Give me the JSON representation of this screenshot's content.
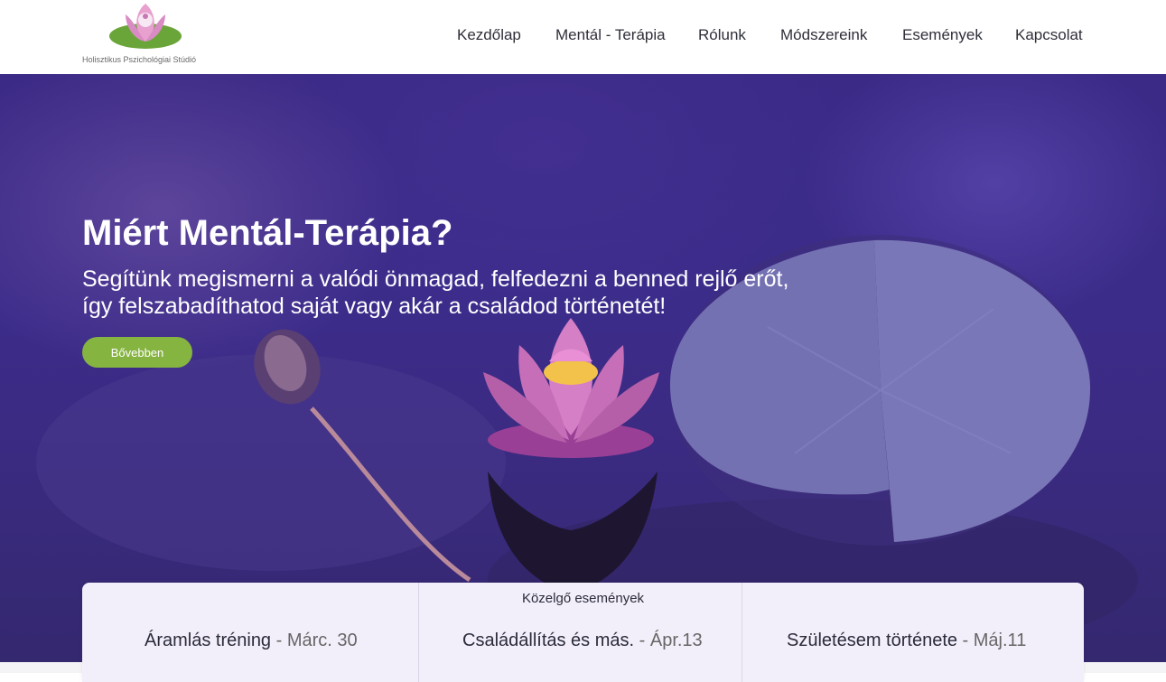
{
  "header": {
    "logo_text": "Holisztikus Pszichológiai Stúdió",
    "nav": [
      {
        "label": "Kezdőlap"
      },
      {
        "label": "Mentál - Terápia"
      },
      {
        "label": "Rólunk"
      },
      {
        "label": "Módszereink"
      },
      {
        "label": "Események"
      },
      {
        "label": "Kapcsolat"
      }
    ]
  },
  "hero": {
    "title": "Miért Mentál-Terápia?",
    "subtitle": "Segítünk megismerni a valódi önmagad, felfedezni a benned rejlő erőt, így felszabadíthatod saját vagy akár a családod történetét!",
    "button_label": "Bővebben",
    "image": "lotus-flower-and-lily-pad-on-purple-water"
  },
  "events": {
    "title": "Közelgő események",
    "items": [
      {
        "name": "Áramlás tréning",
        "date": " - Márc. 30"
      },
      {
        "name": "Családállítás és más.",
        "date": " - Ápr.13"
      },
      {
        "name": "Születésem története",
        "date": " - Máj.11"
      }
    ]
  },
  "colors": {
    "accent_green": "#86b441",
    "hero_purple": "#3c2c8a",
    "panel_bg": "#f3effa"
  }
}
